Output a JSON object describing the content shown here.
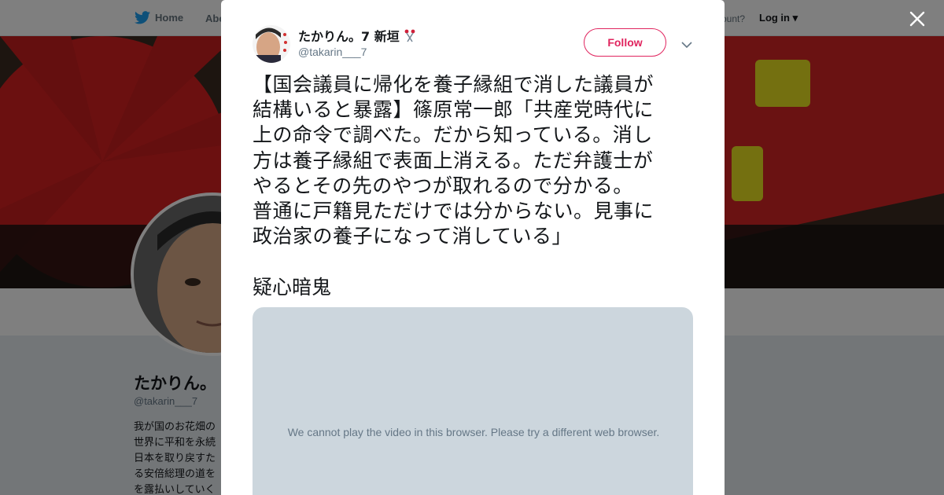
{
  "topbar": {
    "home_label": "Home",
    "about_label": "Abo",
    "account_question": "ccount?",
    "login_label": "Log in"
  },
  "profile": {
    "name": "たかりん。",
    "handle": "@takarin___7",
    "bio_lines": [
      "我が国のお花畑の",
      "世界に平和を永続",
      "日本を取り戻すた",
      "る安倍総理の道を",
      "を露払いしていく"
    ]
  },
  "tweet": {
    "author_name": "たかりん。7 新垣",
    "author_handle": "@takarin___7",
    "follow_label": "Follow",
    "text_lines": [
      "【国会議員に帰化を養子縁組で消した議員が",
      "結構いると暴露】篠原常一郎「共産党時代に",
      "上の命令で調べた。だから知っている。消し",
      "方は養子縁組で表面上消える。ただ弁護士が",
      "やるとその先のやつが取れるので分かる。",
      "普通に戸籍見ただけでは分からない。見事に",
      "政治家の養子になって消している」"
    ],
    "tail_text": "疑心暗鬼",
    "video_message": "We cannot play the video in this browser. Please try a different web browser."
  },
  "colors": {
    "accent": "#e0245e",
    "twitter_blue": "#1da1f2",
    "video_bg": "#ccd6dd"
  }
}
